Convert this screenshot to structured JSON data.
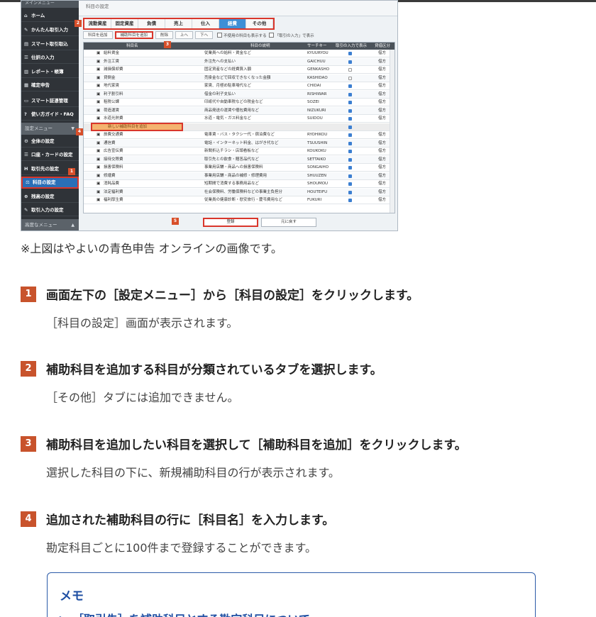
{
  "screenshot": {
    "sidebar": {
      "top_label": "メインメニュー",
      "items": [
        {
          "icon": "⌂",
          "label": "ホーム"
        },
        {
          "icon": "✎",
          "label": "かんたん取引入力"
        },
        {
          "icon": "▤",
          "label": "スマート取引取込"
        },
        {
          "icon": "☰",
          "label": "仕訳の入力"
        },
        {
          "icon": "▥",
          "label": "レポート・帳簿"
        },
        {
          "icon": "▦",
          "label": "確定申告"
        }
      ],
      "items2": [
        {
          "icon": "▭",
          "label": "スマート証憑管理"
        },
        {
          "icon": "?",
          "label": "使い方ガイド・FAQ"
        }
      ],
      "section_settings": "設定メニュー",
      "settings_items": [
        {
          "icon": "⚙",
          "label": "全体の設定"
        },
        {
          "icon": "☰",
          "label": "口座・カードの設定"
        },
        {
          "icon": "H",
          "label": "取引先の設定"
        },
        {
          "icon": "⚖",
          "label": "科目の設定"
        },
        {
          "icon": "⊕",
          "label": "残高の設定"
        },
        {
          "icon": "✎",
          "label": "取引入力の設定"
        }
      ],
      "section_advanced": "高度なメニュー"
    },
    "header_title": "科目の設定",
    "tabs": [
      "流動資産",
      "固定資産",
      "負債",
      "売上",
      "仕入",
      "経費",
      "その他"
    ],
    "selected_tab": "経費",
    "toolbar": {
      "add_account": "科目を追加",
      "add_sub_account": "補助科目を追加",
      "delete": "削除",
      "up": "上へ",
      "down": "下へ",
      "show_unused": "不使用の科目も表示する",
      "show_in_entry": "「取引の入力」で表示"
    },
    "grid_headers": [
      "科目名",
      "科目の説明",
      "サーチキー",
      "取引の入力で表示",
      "貸借区分"
    ],
    "rows": [
      {
        "name": "給料賃金",
        "desc": "従業員への給料・賃金など",
        "key": "KYUURYOU",
        "shown": true,
        "side": "借方"
      },
      {
        "name": "外注工賃",
        "desc": "外注先への支払い",
        "key": "GAICHUU",
        "shown": true,
        "side": "借方"
      },
      {
        "name": "減価償却費",
        "desc": "固定資産などの経費算入額",
        "key": "GENKASHO",
        "shown": false,
        "side": "借方"
      },
      {
        "name": "貸倒金",
        "desc": "売掛金などで回収できなくなった金額",
        "key": "KASHIDAO",
        "shown": false,
        "side": "借方"
      },
      {
        "name": "地代家賃",
        "desc": "家賃、月極め駐車場代など",
        "key": "CHIDAI",
        "shown": true,
        "side": "借方"
      },
      {
        "name": "利子割引料",
        "desc": "借金の利子支払い",
        "key": "RISHIWAR",
        "shown": true,
        "side": "借方"
      },
      {
        "name": "租税公課",
        "desc": "印紙代や自動車税などの税金など",
        "key": "SOZEI",
        "shown": true,
        "side": "借方"
      },
      {
        "name": "荷造運賃",
        "desc": "商品発送の運賃や梱包費用など",
        "key": "NIZUKURI",
        "shown": true,
        "side": "借方"
      },
      {
        "name": "水道光熱費",
        "desc": "水道・電気・ガス料金など",
        "key": "SUIDOU",
        "shown": true,
        "side": "借方"
      },
      {
        "name": "新しい補助科目を追加",
        "desc": "",
        "key": "",
        "shown": true,
        "side": ""
      },
      {
        "name": "旅費交通費",
        "desc": "電車賃・バス・タクシー代・宿泊費など",
        "key": "RYOHIKOU",
        "shown": true,
        "side": "借方"
      },
      {
        "name": "通信費",
        "desc": "電話・インターネット料金、はがき代など",
        "key": "TSUUSHIN",
        "shown": true,
        "side": "借方"
      },
      {
        "name": "広告宣伝費",
        "desc": "新聞折込チラシ・店頭看板など",
        "key": "KOUKOKU",
        "shown": true,
        "side": "借方"
      },
      {
        "name": "接待交際費",
        "desc": "取引先との飲食・贈答品代など",
        "key": "SETTAIKO",
        "shown": true,
        "side": "借方"
      },
      {
        "name": "損害保険料",
        "desc": "事業用店舗・商品への損害保険料",
        "key": "SONGAIHO",
        "shown": true,
        "side": "借方"
      },
      {
        "name": "修繕費",
        "desc": "事業用店舗・商品の補修・修理費用",
        "key": "SHUUZEN",
        "shown": true,
        "side": "借方"
      },
      {
        "name": "消耗品費",
        "desc": "短期間で消費する事務用品など",
        "key": "SHOUMOU",
        "shown": true,
        "side": "借方"
      },
      {
        "name": "法定福利費",
        "desc": "社会保険料、労働保険料などの事業主負担分",
        "key": "HOUTEIFU",
        "shown": true,
        "side": "借方"
      },
      {
        "name": "福利厚生費",
        "desc": "従業員の健康診断・慰安旅行・慶弔費用など",
        "key": "FUKURI",
        "shown": true,
        "side": "借方"
      }
    ],
    "footer": {
      "register": "登録",
      "reset": "元に戻す"
    },
    "markers": [
      "1",
      "2",
      "3",
      "4",
      "5"
    ]
  },
  "caption": "※上図はやよいの青色申告 オンラインの画像です。",
  "steps": [
    {
      "num": "1",
      "title": "画面左下の［設定メニュー］から［科目の設定］をクリックします。",
      "desc": "［科目の設定］画面が表示されます。"
    },
    {
      "num": "2",
      "title": "補助科目を追加する科目が分類されているタブを選択します。",
      "desc": "［その他］タブには追加できません。"
    },
    {
      "num": "3",
      "title": "補助科目を追加したい科目を選択して［補助科目を追加］をクリックします。",
      "desc": "選択した科目の下に、新規補助科目の行が表示されます。"
    },
    {
      "num": "4",
      "title": "追加された補助科目の行に［科目名］を入力します。",
      "desc": "勘定科目ごとに100件まで登録することができます。"
    }
  ],
  "memo": {
    "title": "メモ",
    "item": "▶ ［取引先］を補助科目とする勘定科目について"
  },
  "colors": {
    "badge": "#c8532c",
    "memo_border": "#2b5aa8",
    "highlight": "#d9362b",
    "tab_selected": "#3d8fd6"
  }
}
